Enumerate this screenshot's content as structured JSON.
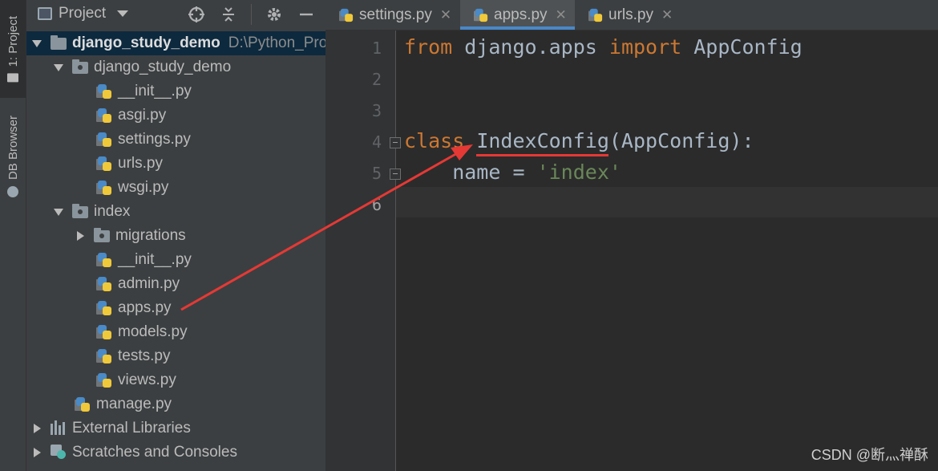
{
  "toolstrip": {
    "project_tab": "1: Project",
    "db_tab": "DB Browser"
  },
  "project_panel": {
    "title": "Project",
    "tree": [
      {
        "label": "django_study_demo",
        "path": "D:\\Python_Pro",
        "type": "project",
        "expanded": true
      },
      {
        "label": "django_study_demo",
        "type": "folder",
        "expanded": true
      },
      {
        "label": "__init__.py",
        "type": "python"
      },
      {
        "label": "asgi.py",
        "type": "python"
      },
      {
        "label": "settings.py",
        "type": "python"
      },
      {
        "label": "urls.py",
        "type": "python"
      },
      {
        "label": "wsgi.py",
        "type": "python"
      },
      {
        "label": "index",
        "type": "folder",
        "expanded": true
      },
      {
        "label": "migrations",
        "type": "folder",
        "expanded": false
      },
      {
        "label": "__init__.py",
        "type": "python"
      },
      {
        "label": "admin.py",
        "type": "python"
      },
      {
        "label": "apps.py",
        "type": "python"
      },
      {
        "label": "models.py",
        "type": "python"
      },
      {
        "label": "tests.py",
        "type": "python"
      },
      {
        "label": "views.py",
        "type": "python"
      },
      {
        "label": "manage.py",
        "type": "python"
      },
      {
        "label": "External Libraries",
        "type": "libraries",
        "expanded": false
      },
      {
        "label": "Scratches and Consoles",
        "type": "scratches",
        "expanded": false
      }
    ]
  },
  "editor": {
    "tabs": [
      {
        "label": "settings.py",
        "active": false
      },
      {
        "label": "apps.py",
        "active": true
      },
      {
        "label": "urls.py",
        "active": false
      }
    ],
    "line_numbers": [
      "1",
      "2",
      "3",
      "4",
      "5",
      "6"
    ],
    "code": {
      "l1_from": "from",
      "l1_mod": " django.apps ",
      "l1_import": "import",
      "l1_name": " AppConfig",
      "l4_class": "class",
      "l4_rest": " IndexConfig(AppConfig):",
      "l5_name": "    name = ",
      "l5_str": "'index'"
    },
    "current_line": 6
  },
  "colors": {
    "keyword": "#cc7832",
    "string": "#6a8759",
    "annotation": "#e53935",
    "selection": "#0d293e"
  },
  "watermark": "CSDN @断灬禅酥"
}
